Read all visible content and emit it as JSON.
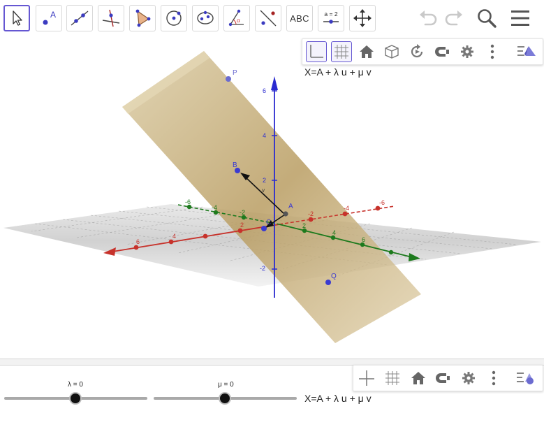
{
  "toolbar": {
    "tools": [
      {
        "name": "move-tool",
        "selected": true
      },
      {
        "name": "point-tool"
      },
      {
        "name": "line-tool"
      },
      {
        "name": "perpendicular-line-tool"
      },
      {
        "name": "polygon-tool"
      },
      {
        "name": "circle-tool"
      },
      {
        "name": "conic-tool"
      },
      {
        "name": "angle-tool"
      },
      {
        "name": "reflect-tool"
      },
      {
        "name": "text-tool",
        "label": "ABC"
      },
      {
        "name": "slider-tool",
        "label": "a = 2"
      },
      {
        "name": "move-graphics-view-tool"
      }
    ],
    "right": [
      "undo-icon",
      "redo-icon",
      "search-icon",
      "menu-icon"
    ]
  },
  "view3d": {
    "style_bar": [
      "axes-toggle",
      "grid-toggle",
      "home-icon",
      "view-in-front-icon",
      "rotate-view-icon",
      "projection-icon",
      "settings-icon",
      "more-icon",
      "view-menu-icon"
    ],
    "equation": "X=A + λ u + μ v",
    "points": [
      "P",
      "B",
      "A",
      "C",
      "Q"
    ],
    "x_ticks": [
      "-6",
      "-4",
      "-2",
      "2",
      "4",
      "6"
    ],
    "y_ticks": [
      "-6",
      "-4",
      "-2",
      "2",
      "4",
      "6"
    ],
    "z_ticks": [
      "6",
      "4",
      "2",
      "-2"
    ],
    "vector_label": "v",
    "colors": {
      "x_axis": "#c7322b",
      "y_axis": "#1d7a1d",
      "z_axis": "#2b2bd0",
      "plane": "#c8b27c",
      "point": "#4a4ad0"
    }
  },
  "algebra": {
    "style_bar": [
      "axes-toggle",
      "grid-toggle",
      "home-icon",
      "projection-icon",
      "settings-icon",
      "more-icon",
      "view-menu-icon"
    ],
    "equation": "X=A + λ u + μ v",
    "sliders": [
      {
        "label": "λ = 0",
        "value": 0,
        "min": -5,
        "max": 5
      },
      {
        "label": "μ = 0",
        "value": 0,
        "min": -5,
        "max": 5
      }
    ]
  }
}
